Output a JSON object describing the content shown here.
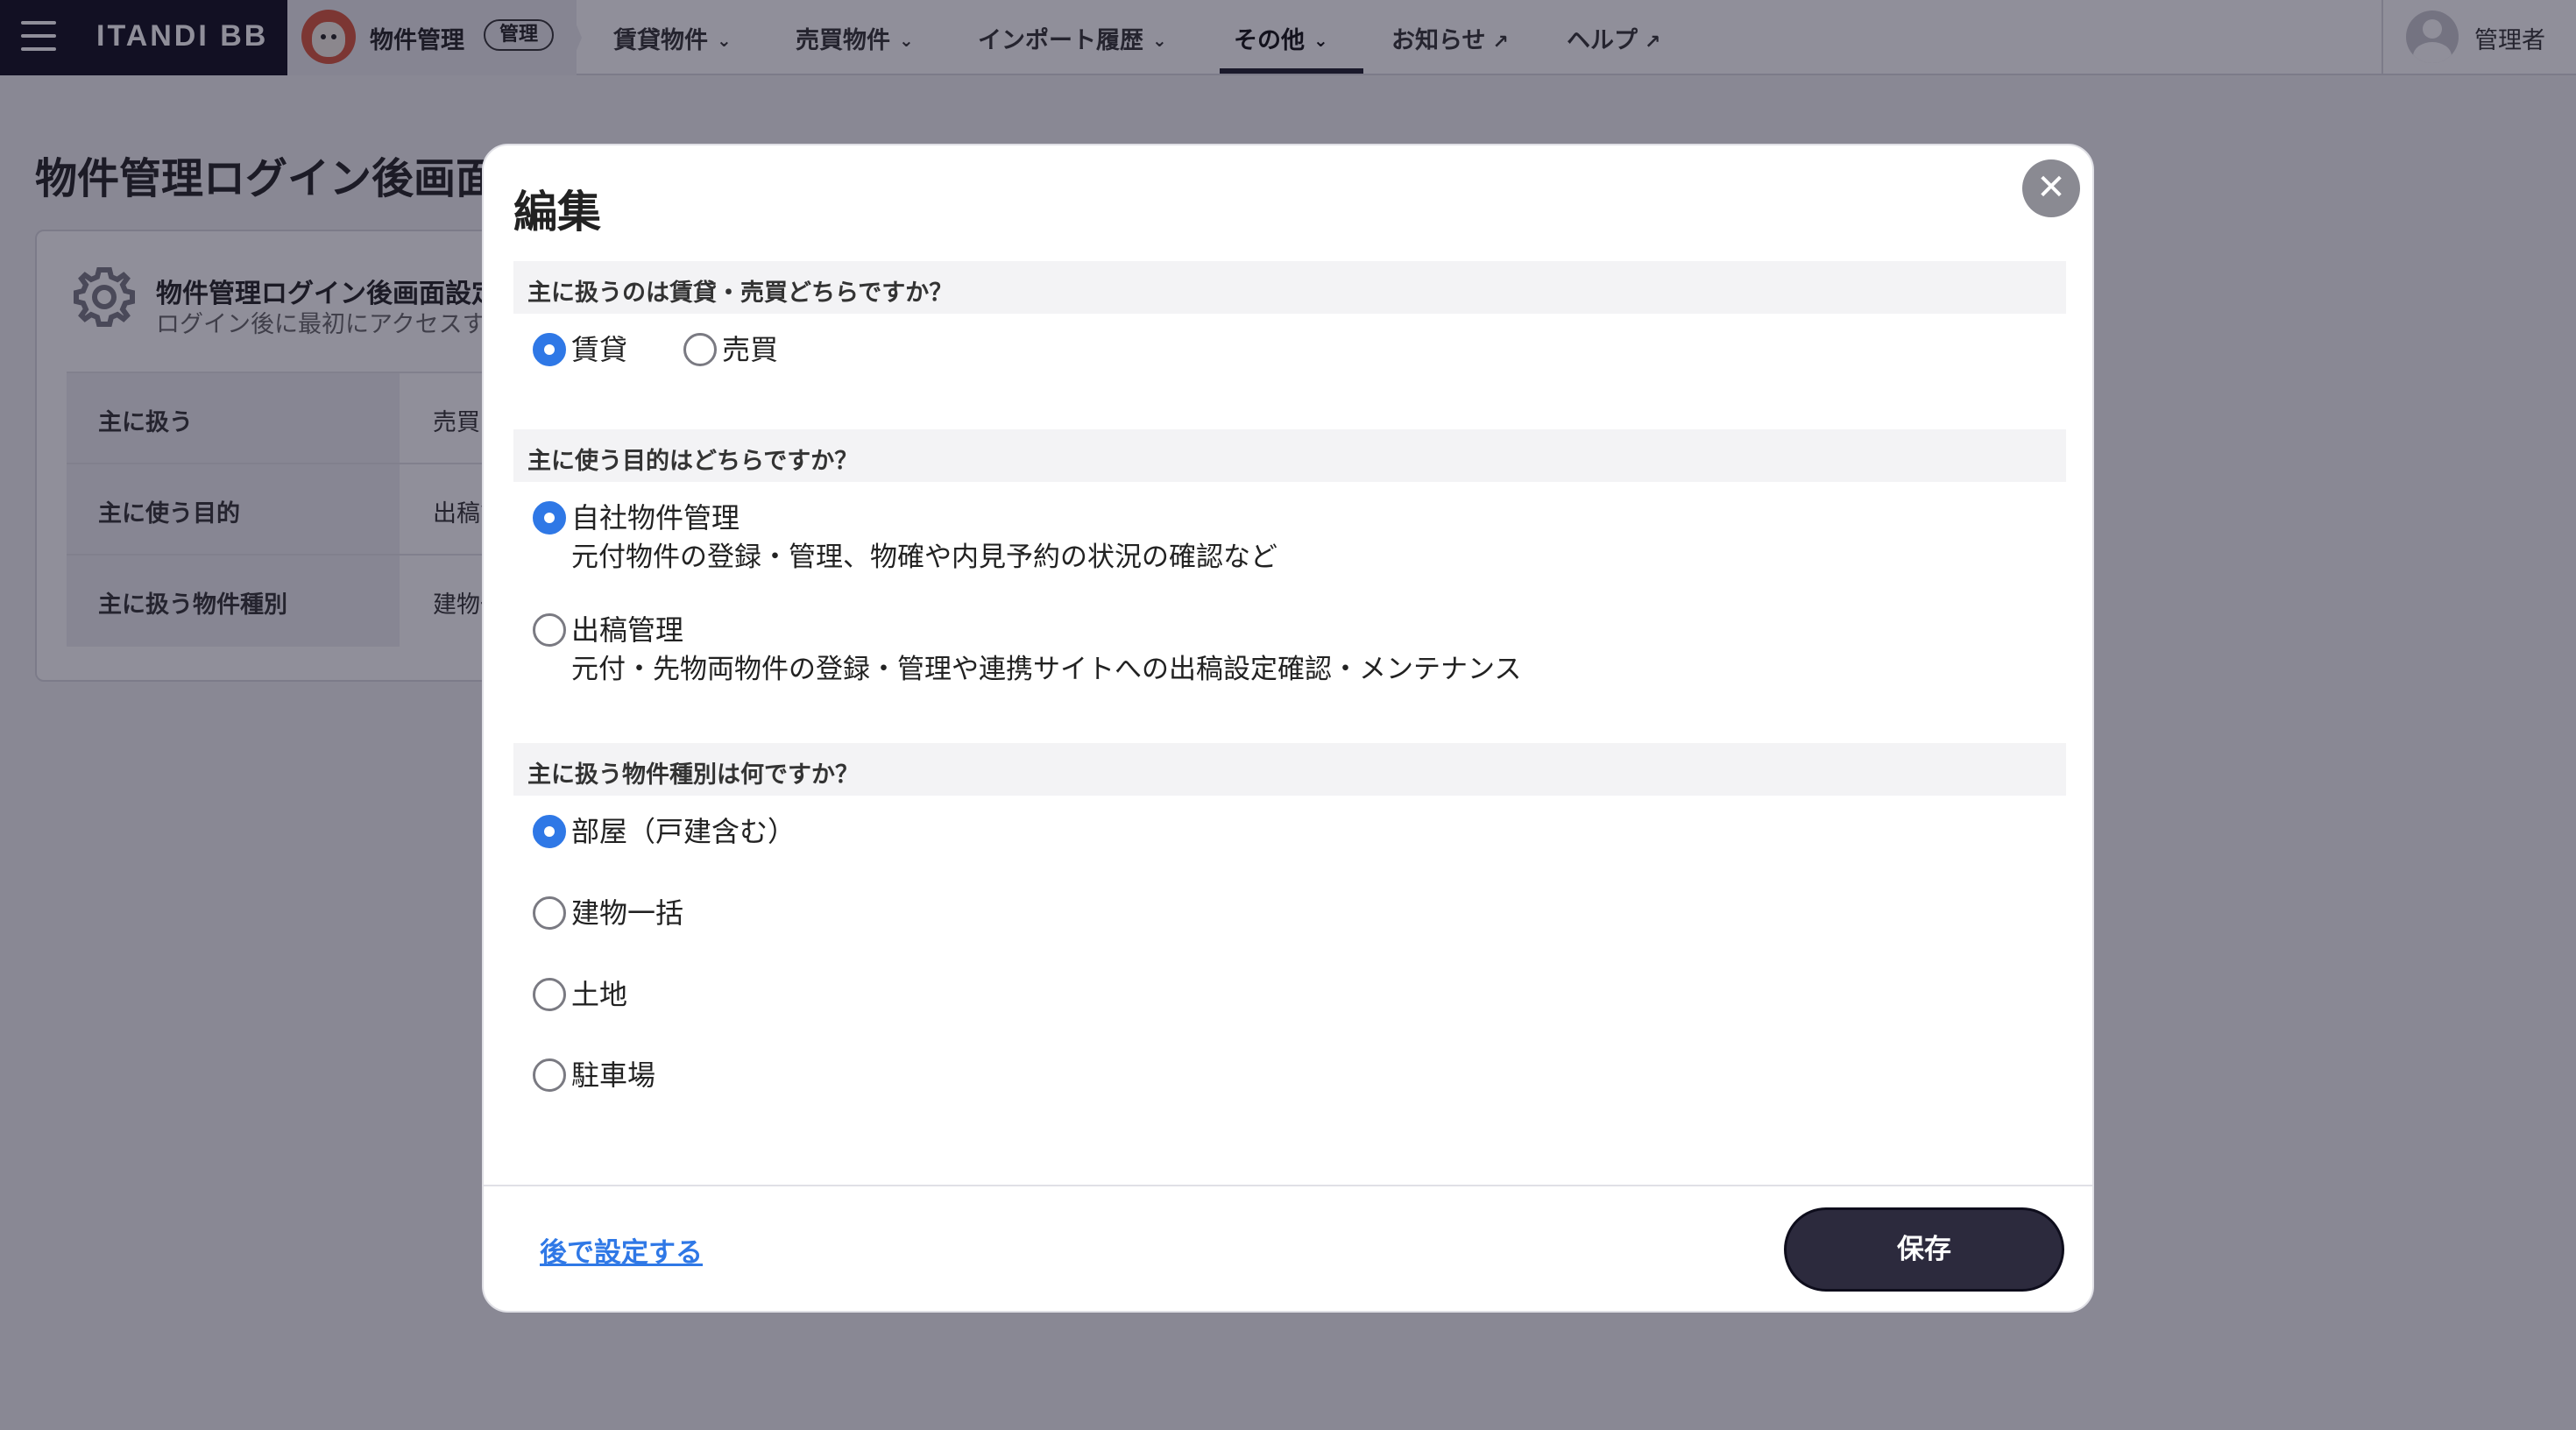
{
  "nav": {
    "brand": "ITANDI BB",
    "app_name": "物件管理",
    "app_badge": "管理",
    "items": [
      {
        "label": "賃貸物件",
        "chevron": "chevron-down-icon"
      },
      {
        "label": "売買物件",
        "chevron": "chevron-down-icon"
      },
      {
        "label": "インポート履歴",
        "chevron": "chevron-down-icon"
      },
      {
        "label": "その他",
        "chevron": "chevron-down-icon",
        "active": true
      },
      {
        "label": "お知らせ",
        "icon": "external-link-icon"
      },
      {
        "label": "ヘルプ",
        "icon": "external-link-icon"
      }
    ],
    "user_name": "管理者"
  },
  "page": {
    "title": "物件管理ログイン後画面設定",
    "card": {
      "title": "物件管理ログイン後画面設定",
      "subtitle": "ログイン後に最初にアクセスする画面を設定します",
      "rows": [
        {
          "label": "主に扱う",
          "value": "売買"
        },
        {
          "label": "主に使う目的",
          "value": "出稿管理"
        },
        {
          "label": "主に扱う物件種別",
          "value": "建物一括"
        }
      ]
    }
  },
  "modal": {
    "title": "編集",
    "close_icon": "close-icon",
    "sections": [
      {
        "heading": "主に扱うのは賃貸・売買どちらですか？",
        "options": [
          {
            "label": "賃貸",
            "checked": true
          },
          {
            "label": "売買",
            "checked": false
          }
        ]
      },
      {
        "heading": "主に使う目的はどちらですか？",
        "options": [
          {
            "label": "自社物件管理",
            "desc": "元付物件の登録・管理、物確や内見予約の状況の確認など",
            "checked": true
          },
          {
            "label": "出稿管理",
            "desc": "元付・先物両物件の登録・管理や連携サイトへの出稿設定確認・メンテナンス",
            "checked": false
          }
        ]
      },
      {
        "heading": "主に扱う物件種別は何ですか？",
        "options": [
          {
            "label": "部屋（戸建含む）",
            "checked": true
          },
          {
            "label": "建物一括",
            "checked": false
          },
          {
            "label": "土地",
            "checked": false
          },
          {
            "label": "駐車場",
            "checked": false
          }
        ]
      }
    ],
    "later_link": "後で設定する",
    "save_label": "保存"
  },
  "colors": {
    "accent_blue": "#2f78e6",
    "dark_navy": "#0e0d1c",
    "save_button": "#2c2a3d"
  }
}
